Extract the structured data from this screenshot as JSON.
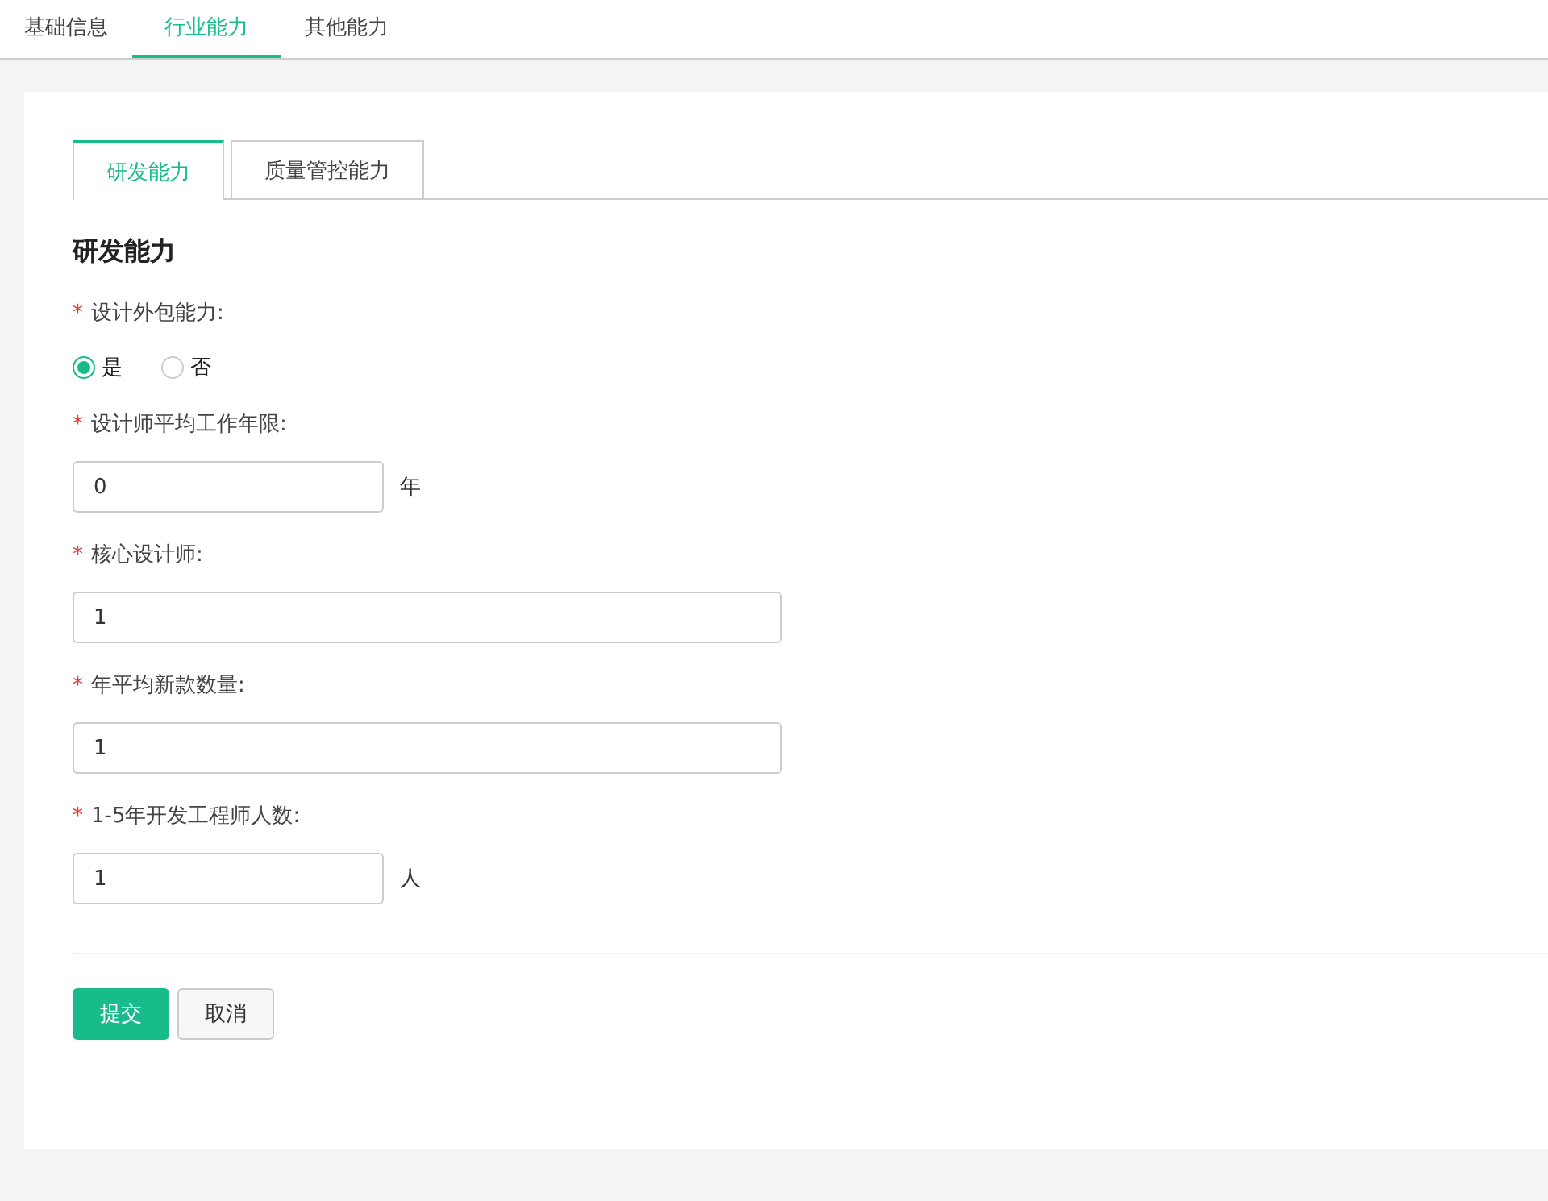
{
  "top_tabs": [
    {
      "label": "基础信息",
      "selected": false
    },
    {
      "label": "行业能力",
      "selected": true
    },
    {
      "label": "其他能力",
      "selected": false
    }
  ],
  "sub_tabs": [
    {
      "label": "研发能力",
      "selected": true
    },
    {
      "label": "质量管控能力",
      "selected": false
    }
  ],
  "section_title": "研发能力",
  "fields": [
    {
      "kind": "radio",
      "required_mark": "*",
      "label": "设计外包能力:",
      "options": [
        {
          "label": "是",
          "selected": true
        },
        {
          "label": "否",
          "selected": false
        }
      ]
    },
    {
      "kind": "short",
      "required_mark": "*",
      "label": "设计师平均工作年限:",
      "value": "0",
      "unit": "年"
    },
    {
      "kind": "long",
      "required_mark": "*",
      "label": "核心设计师:",
      "value": "1"
    },
    {
      "kind": "long",
      "required_mark": "*",
      "label": "年平均新款数量:",
      "value": "1"
    },
    {
      "kind": "short",
      "required_mark": "*",
      "label": "1-5年开发工程师人数:",
      "value": "1",
      "unit": "人"
    }
  ],
  "buttons": [
    {
      "label": "提交",
      "kind": "primary"
    },
    {
      "label": "取消",
      "kind": "default"
    }
  ]
}
